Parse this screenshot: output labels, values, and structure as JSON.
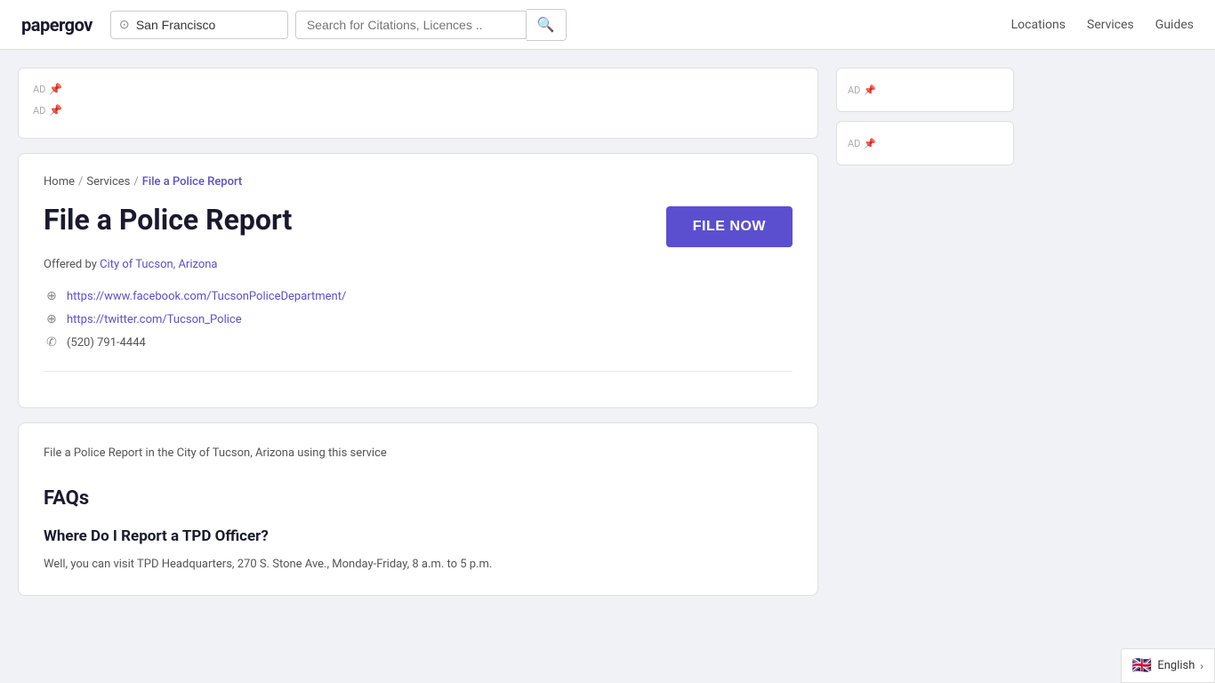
{
  "header": {
    "logo": "papergov",
    "location_placeholder": "San Francisco",
    "search_placeholder": "Search for Citations, Licences ..",
    "nav": {
      "locations": "Locations",
      "services": "Services",
      "guides": "Guides"
    }
  },
  "ads": {
    "label1": "AD",
    "label2": "AD",
    "sidebar_label1": "AD",
    "sidebar_label2": "AD"
  },
  "breadcrumb": {
    "home": "Home",
    "sep1": "/",
    "services": "Services",
    "sep2": "/",
    "current": "File a Police Report"
  },
  "service": {
    "title": "File a Police Report",
    "file_now_label": "FILE NOW",
    "offered_by_prefix": "Offered by",
    "offered_by_link": "City of Tucson, Arizona",
    "links": {
      "facebook": "https://www.facebook.com/TucsonPoliceDepartment/",
      "twitter": "https://twitter.com/Tucson_Police",
      "phone": "(520) 791-4444"
    }
  },
  "description": {
    "text": "File a Police Report in the City of Tucson, Arizona using this service",
    "faqs_title": "FAQs",
    "faq1": {
      "question": "Where Do I Report a TPD Officer?",
      "answer_preview": "Well, you can visit TPD Headquarters, 270 S. Stone Ave., Monday-Friday, 8 a.m. to 5 p.m."
    }
  },
  "language": {
    "flag": "🇬🇧",
    "label": "English"
  }
}
